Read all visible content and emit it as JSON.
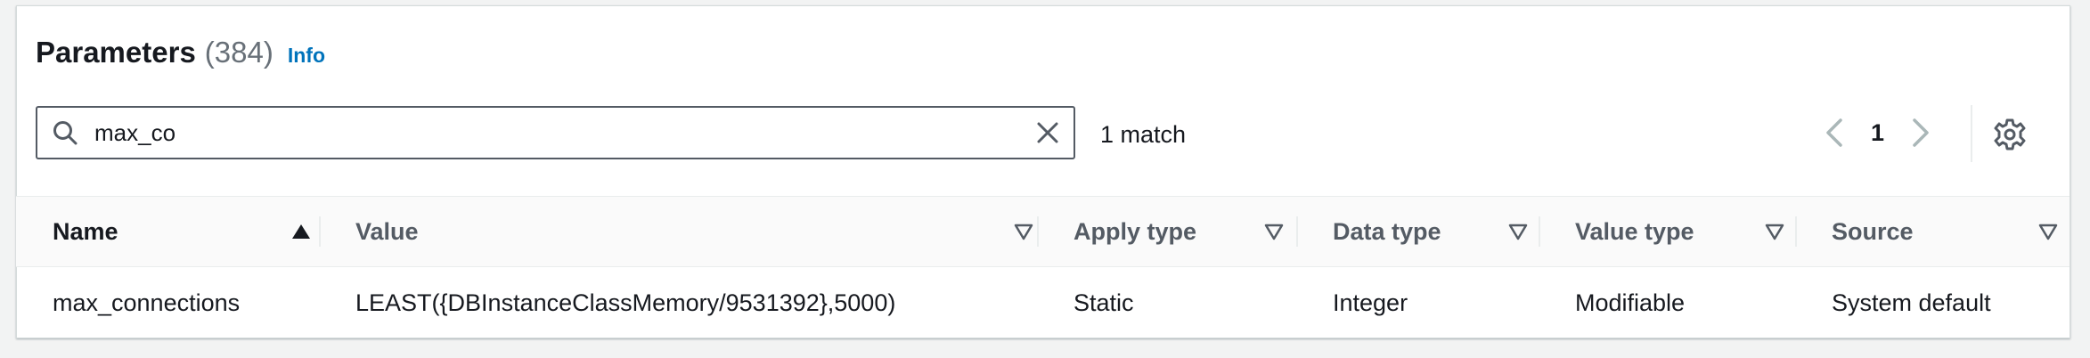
{
  "header": {
    "title": "Parameters",
    "count": "(384)",
    "info_label": "Info"
  },
  "search": {
    "value": "max_co",
    "icon": "search-icon",
    "clear_icon": "close-icon"
  },
  "match_count": "1 match",
  "pagination": {
    "current_page": "1",
    "prev_icon": "chevron-left-icon",
    "next_icon": "chevron-right-icon"
  },
  "settings_icon": "gear-icon",
  "table": {
    "columns": [
      {
        "label": "Name",
        "sort": "ascending"
      },
      {
        "label": "Value",
        "sort": "none"
      },
      {
        "label": "Apply type",
        "sort": "none"
      },
      {
        "label": "Data type",
        "sort": "none"
      },
      {
        "label": "Value type",
        "sort": "none"
      },
      {
        "label": "Source",
        "sort": "none"
      }
    ],
    "rows": [
      {
        "name": "max_connections",
        "value": "LEAST({DBInstanceClassMemory/9531392},5000)",
        "apply_type": "Static",
        "data_type": "Integer",
        "value_type": "Modifiable",
        "source": "System default"
      }
    ]
  },
  "colors": {
    "link": "#0073bb",
    "text": "#16191f",
    "muted": "#687078",
    "border": "#eaeded"
  }
}
